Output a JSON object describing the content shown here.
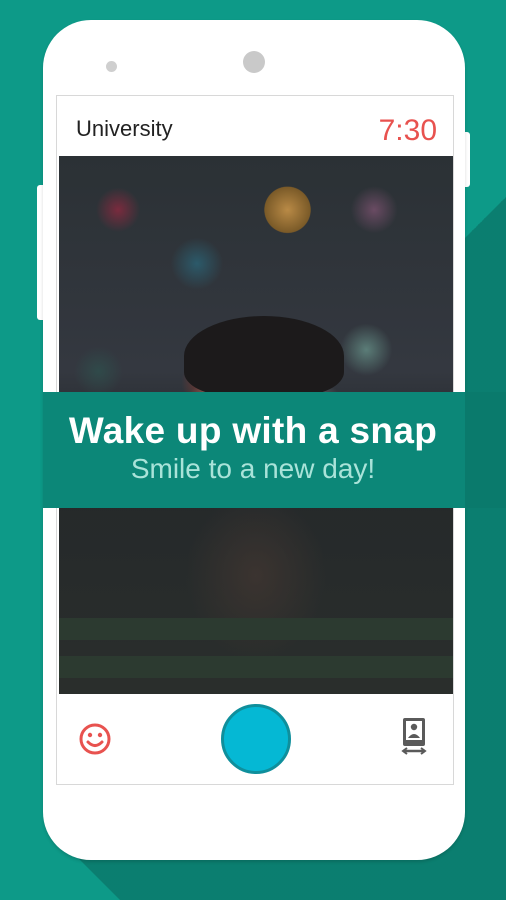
{
  "alarm": {
    "label": "University",
    "time": "7:30"
  },
  "promo": {
    "headline": "Wake up with a snap",
    "subline": "Smile to a new day!"
  },
  "controls": {
    "left_icon": "smile-icon",
    "center_button": "shutter-button",
    "right_icon": "switch-camera-icon"
  },
  "colors": {
    "background": "#0d9a88",
    "banner": "#0c8778",
    "alarm_time": "#e8524f",
    "shutter": "#05b8d4",
    "icon_red": "#e8524f"
  }
}
